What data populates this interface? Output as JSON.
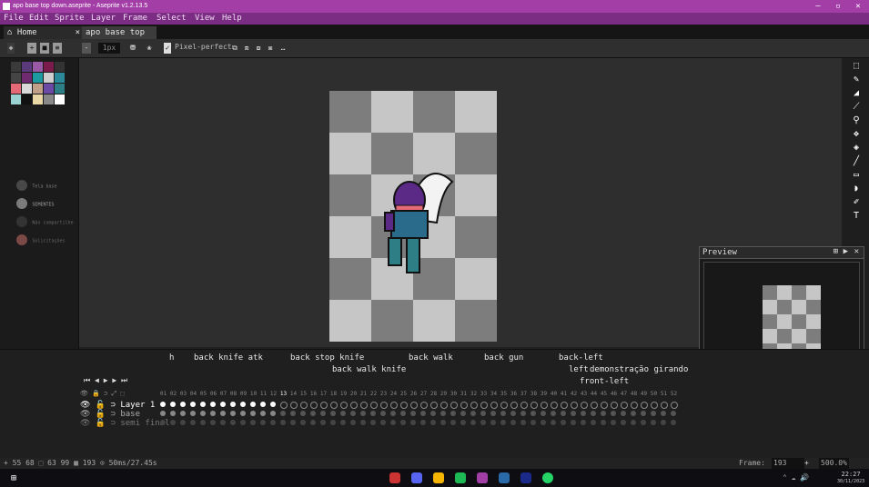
{
  "window": {
    "title": "apo base top down.aseprite - Aseprite v1.2.13.5"
  },
  "menu": [
    "File",
    "Edit",
    "Sprite",
    "Layer",
    "Frame",
    "Select",
    "View",
    "Help"
  ],
  "tabs": [
    {
      "label": "Home"
    },
    {
      "label": "apo base top d"
    }
  ],
  "toolbar": {
    "pixel_perfect": "Pixel-perfect"
  },
  "palette": {
    "colors": [
      "#3a3a3a",
      "#5a3a7a",
      "#9a59a5",
      "#7a1b4b",
      "#333",
      "#444",
      "#702a6f",
      "#1c9a9f",
      "#cfcfcf",
      "#2a8a9a",
      "#e56a78",
      "#d9d9d9",
      "#c0a089",
      "#6a4aa4",
      "#2e7f85",
      "#9ad3d1",
      "#111",
      "#e9d8a6",
      "#888",
      "#fff"
    ]
  },
  "floating_labels": [
    "SEMENTES",
    "Não compartilhe",
    "Tela base",
    "Solicitações"
  ],
  "colors": {
    "foreground_hex": "#121321",
    "background_hex": "#7E3770"
  },
  "preview": {
    "title": "Preview"
  },
  "timeline": {
    "tags": [
      "h",
      "back knife atk",
      "back stop knife",
      "back walk knife",
      "back walk",
      "back gun",
      "back-left",
      "left",
      "demonstração girando",
      "front-left"
    ],
    "frame_numbers": [
      "01",
      "02",
      "03",
      "04",
      "05",
      "06",
      "07",
      "08",
      "09",
      "10",
      "11",
      "12",
      "13",
      "14",
      "15",
      "16",
      "17",
      "18",
      "19",
      "20",
      "21",
      "22",
      "23",
      "24",
      "25",
      "26",
      "27",
      "28",
      "29",
      "30",
      "31",
      "32",
      "33",
      "34",
      "35",
      "36",
      "37",
      "38",
      "39",
      "40",
      "41",
      "42",
      "43",
      "44",
      "45",
      "46",
      "47",
      "48",
      "49",
      "50",
      "51",
      "52"
    ],
    "current_frame": "13",
    "layers": [
      {
        "name": "Layer 1"
      },
      {
        "name": "base"
      },
      {
        "name": "semi final"
      }
    ]
  },
  "status": {
    "left": "+ 55 68   ⬚ 63 99  ▦ 193  ⊙ 50ms/27.45s",
    "frame_label": "Frame:",
    "frame_value": "193",
    "zoom": "500.0%"
  },
  "taskbar": {
    "time": "22:27",
    "date": "30/11/2023"
  }
}
